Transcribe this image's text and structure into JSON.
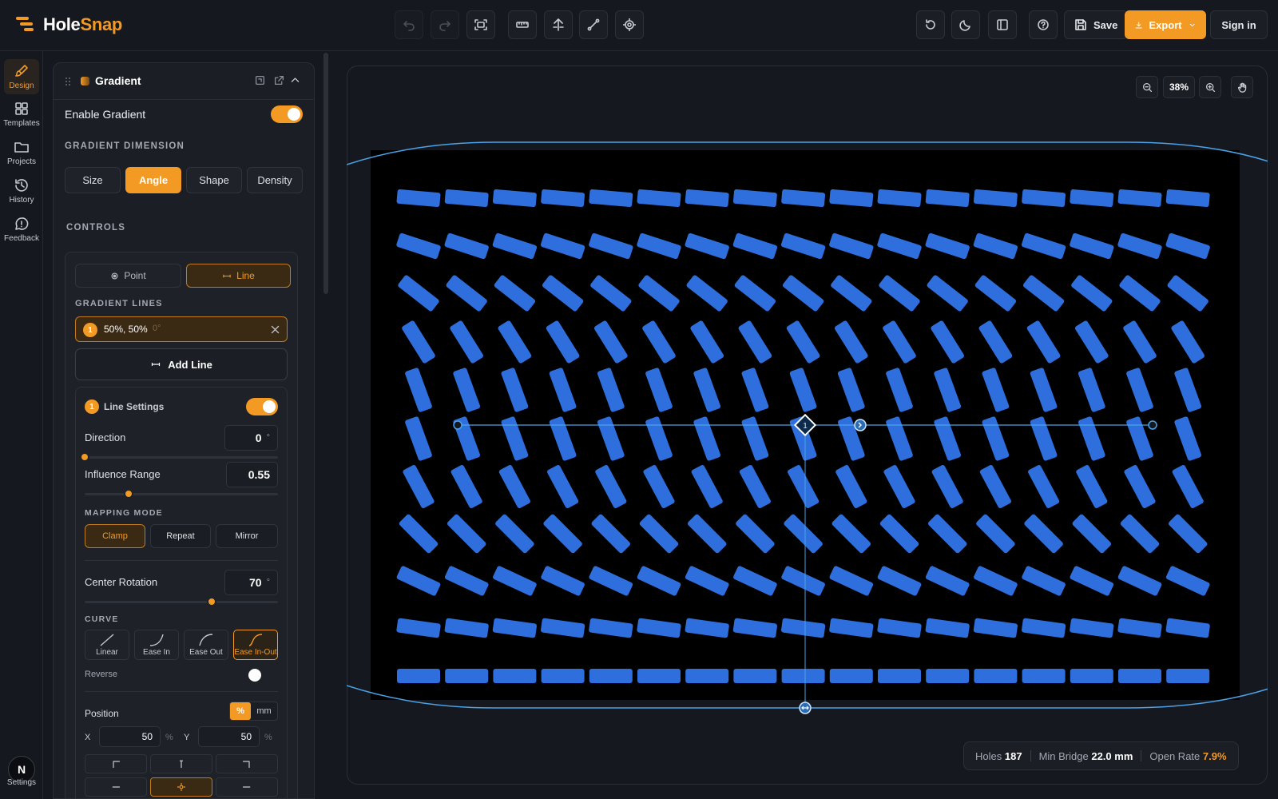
{
  "brand": {
    "name_part1": "Hole",
    "name_part2": "Snap"
  },
  "toolbar": {
    "tools": [
      "undo-icon",
      "redo-icon",
      "fit-screen-icon",
      "ruler-icon",
      "align-icon",
      "path-icon",
      "target-icon"
    ],
    "right_icons": [
      "reset-icon",
      "moon-icon",
      "layout-icon",
      "help-icon"
    ],
    "save_label": "Save",
    "export_label": "Export",
    "signin_label": "Sign in"
  },
  "rail": {
    "items": [
      {
        "label": "Design",
        "icon": "brush-icon",
        "active": true
      },
      {
        "label": "Templates",
        "icon": "grid-icon"
      },
      {
        "label": "Projects",
        "icon": "folder-icon"
      },
      {
        "label": "History",
        "icon": "history-icon"
      },
      {
        "label": "Feedback",
        "icon": "feedback-icon"
      }
    ],
    "avatar": "N",
    "settings_label": "Settings"
  },
  "panel": {
    "title": "Gradient",
    "enable_label": "Enable Gradient",
    "enabled": true,
    "dimension_heading": "GRADIENT DIMENSION",
    "dimension_tabs": [
      "Size",
      "Angle",
      "Shape",
      "Density"
    ],
    "dimension_active": "Angle",
    "controls_heading": "CONTROLS",
    "mode_tabs": {
      "point": "Point",
      "line": "Line"
    },
    "mode_active": "Line",
    "lines_heading": "GRADIENT LINES",
    "line_entry": {
      "index": "1",
      "position": "50%, 50%",
      "angle": "0°"
    },
    "add_line_label": "Add Line",
    "line_settings": {
      "index": "1",
      "title": "Line Settings",
      "direction_label": "Direction",
      "direction_value": "0",
      "direction_unit": "°",
      "direction_fraction": 0.0,
      "influence_label": "Influence Range",
      "influence_value": "0.55",
      "influence_fraction": 0.25,
      "mapping_heading": "MAPPING MODE",
      "mapping_modes": [
        "Clamp",
        "Repeat",
        "Mirror"
      ],
      "mapping_active": "Clamp",
      "center_rotation_label": "Center Rotation",
      "center_rotation_value": "70",
      "center_rotation_unit": "°",
      "center_rotation_fraction": 0.68,
      "curve_heading": "CURVE",
      "curves": [
        "Linear",
        "Ease In",
        "Ease Out",
        "Ease In-Out"
      ],
      "curve_active": "Ease In-Out",
      "reverse_label": "Reverse",
      "position_label": "Position",
      "unit_options": [
        "%",
        "mm"
      ],
      "unit_active": "%",
      "x_label": "X",
      "x_value": "50",
      "x_unit": "%",
      "y_label": "Y",
      "y_value": "50",
      "y_unit": "%"
    }
  },
  "canvas": {
    "zoom": "38%",
    "hole_color": "#2f6fdd",
    "grid": {
      "columns": 17,
      "rows": 11
    },
    "stats": {
      "holes_label": "Holes",
      "holes_value": "187",
      "bridge_label": "Min Bridge",
      "bridge_value": "22.0 mm",
      "open_label": "Open Rate",
      "open_value": "7.9%"
    }
  },
  "colors": {
    "accent": "#f39a25",
    "bg": "#15181e",
    "panel": "#1b1e25",
    "hole": "#2f6fdd",
    "guide": "#4aa3e8"
  }
}
